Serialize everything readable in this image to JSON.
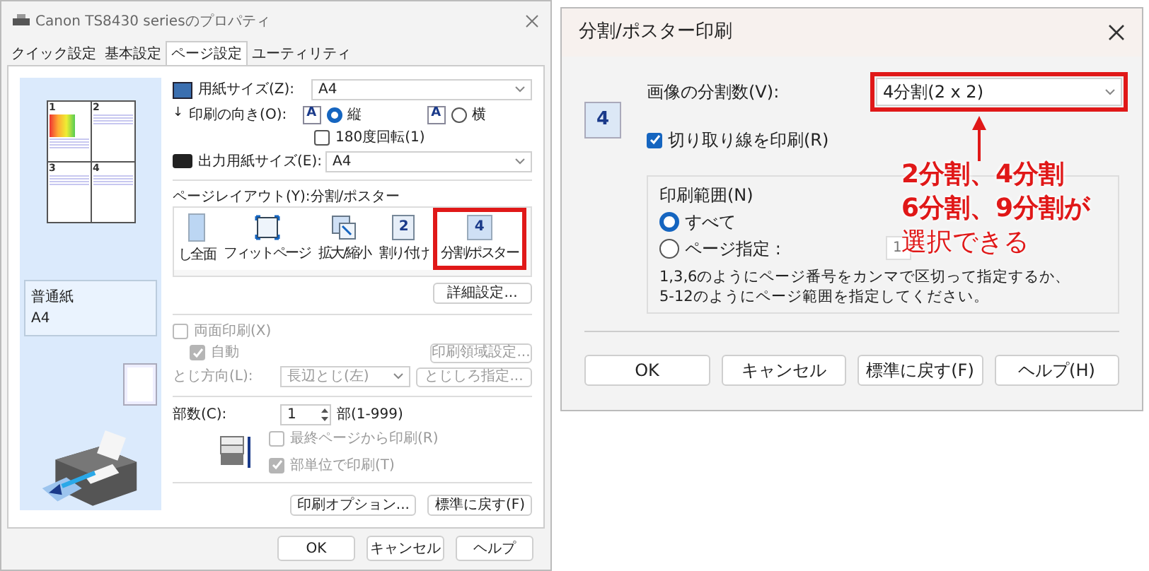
{
  "left_dialog": {
    "title": "Canon TS8430 seriesのプロパティ",
    "tabs": [
      {
        "label": "クイック設定",
        "selected": false
      },
      {
        "label": "基本設定",
        "selected": false
      },
      {
        "label": "ページ設定",
        "selected": true
      },
      {
        "label": "ユーティリティ",
        "selected": false
      }
    ],
    "preview": {
      "sheets": [
        "1",
        "2",
        "3",
        "4"
      ],
      "media_type": "普通紙",
      "media_size": "A4"
    },
    "paper_size": {
      "label": "用紙サイズ(Z):",
      "value": "A4"
    },
    "orientation": {
      "marker": "↓",
      "label": "印刷の向き(O):",
      "options": [
        {
          "icon_glyph": "A",
          "label": "縦",
          "selected": true
        },
        {
          "icon_glyph": "A",
          "label": "横",
          "selected": false
        }
      ]
    },
    "rotate": {
      "label": "180度回転(1)",
      "checked": false
    },
    "output_size": {
      "label": "出力用紙サイズ(E):",
      "value": "A4"
    },
    "page_layout": {
      "label": "ページレイアウト(Y):分割/ポスター",
      "items": [
        {
          "kind": "borderless",
          "label": "し全面",
          "selected": false
        },
        {
          "kind": "fit",
          "label": "フィットページ",
          "selected": false
        },
        {
          "kind": "scale",
          "label": "拡大/縮小",
          "selected": false
        },
        {
          "kind": "layout",
          "glyph": "2",
          "label": "割り付け",
          "selected": false
        },
        {
          "kind": "poster",
          "glyph": "4",
          "label": "分割/ポスター",
          "selected": true
        }
      ]
    },
    "detail_button": "詳細設定...",
    "duplex": {
      "label": "両面印刷(X)",
      "checked": false,
      "disabled": true
    },
    "auto": {
      "label": "自動",
      "checked": true,
      "disabled": true
    },
    "print_area_button": "印刷領域設定...",
    "binding": {
      "label": "とじ方向(L):",
      "value": "長辺とじ(左)",
      "button": "とじしろ指定..."
    },
    "copies": {
      "label": "部数(C):",
      "value": "1",
      "range": "部(1-999)"
    },
    "last_page": {
      "label": "最終ページから印刷(R)",
      "checked": false,
      "disabled": true
    },
    "collate": {
      "label": "部単位で印刷(T)",
      "checked": true,
      "disabled": true
    },
    "option_buttons": [
      "印刷オプション...",
      "標準に戻す(F)"
    ],
    "buttons": [
      "OK",
      "キャンセル",
      "ヘルプ"
    ]
  },
  "right_dialog": {
    "title": "分割/ポスター印刷",
    "icon_glyph": "4",
    "split_count": {
      "label": "画像の分割数(V):",
      "value": "4分割(2 x 2)"
    },
    "cut_lines": {
      "label": "切り取り線を印刷(R)",
      "checked": true
    },
    "range": {
      "label": "印刷範囲(N)",
      "options": [
        {
          "label": "すべて",
          "selected": true
        },
        {
          "label": "ページ指定 :",
          "selected": false
        }
      ],
      "page_value": "1",
      "hint": [
        "1,3,6のようにページ番号をカンマで区切って指定するか、",
        "5-12のようにページ範囲を指定してください。"
      ]
    },
    "buttons": [
      "OK",
      "キャンセル",
      "標準に戻す(F)",
      "ヘルプ(H)"
    ]
  },
  "annotation": {
    "lines": [
      "2分割、4分割",
      "6分割、9分割が",
      "選択できる"
    ]
  }
}
